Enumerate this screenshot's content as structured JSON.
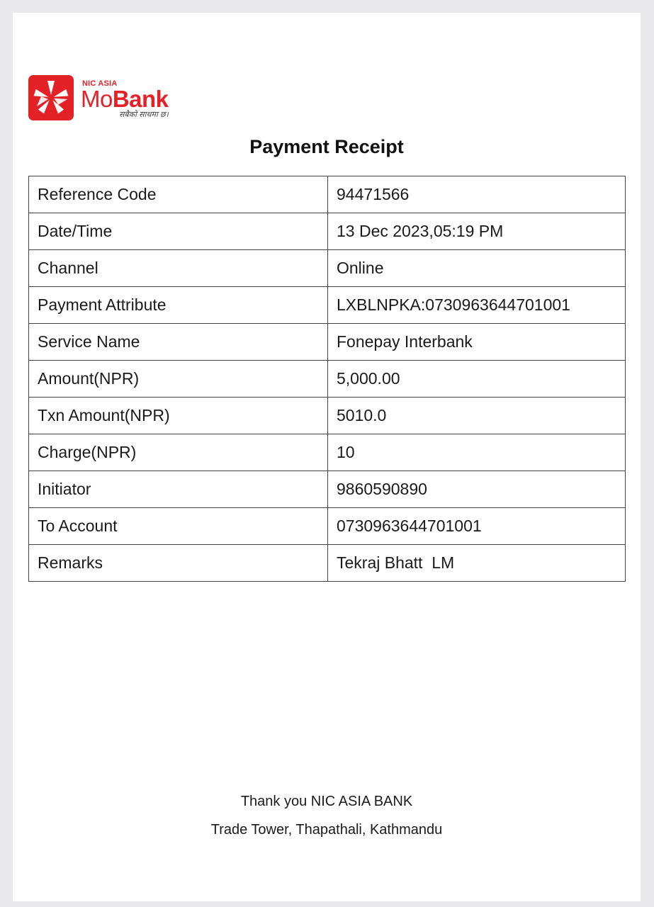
{
  "logo": {
    "small_text": "NIC ASIA",
    "name_part1": "Mo",
    "name_part2": "Bank",
    "tagline": "सबैको साथमा छ।",
    "brand_color": "#e32228"
  },
  "title": "Payment Receipt",
  "rows": [
    {
      "label": "Reference Code",
      "value": "94471566"
    },
    {
      "label": "Date/Time",
      "value": "13 Dec 2023,05:19 PM"
    },
    {
      "label": "Channel",
      "value": "Online"
    },
    {
      "label": "Payment Attribute",
      "value": "LXBLNPKA:0730963644701001"
    },
    {
      "label": "Service Name",
      "value": "Fonepay Interbank"
    },
    {
      "label": "Amount(NPR)",
      "value": "5,000.00"
    },
    {
      "label": "Txn Amount(NPR)",
      "value": "5010.0"
    },
    {
      "label": "Charge(NPR)",
      "value": "10"
    },
    {
      "label": "Initiator",
      "value": "9860590890"
    },
    {
      "label": "To Account",
      "value": "0730963644701001"
    },
    {
      "label": "Remarks",
      "value": "Tekraj Bhatt  LM"
    }
  ],
  "footer": {
    "line1": "Thank you NIC ASIA BANK",
    "line2": "Trade Tower, Thapathali, Kathmandu"
  }
}
